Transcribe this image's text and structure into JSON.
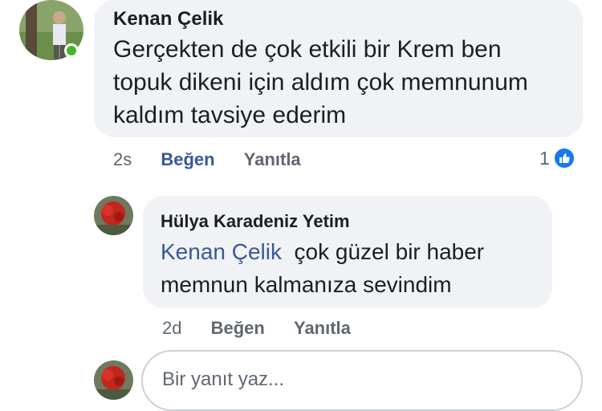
{
  "comments": [
    {
      "author": "Kenan Çelik",
      "text_lines": [
        "Gerçekten de çok etkili bir Krem ben",
        "topuk dikeni için aldım çok memnunum",
        "kaldım tavsiye ederim"
      ],
      "time": "2s",
      "like_label": "Beğen",
      "reply_label": "Yanıtla",
      "reaction_count": "1",
      "reaction_icon": "like-icon",
      "online": true
    },
    {
      "author": "Hülya Karadeniz Yetim",
      "mention": "Kenan Çelik",
      "text_first": "çok güzel bir haber",
      "text_second": "memnun kalmanıza sevindim",
      "time": "2d",
      "like_label": "Beğen",
      "reply_label": "Yanıtla"
    }
  ],
  "reply_input": {
    "placeholder": "Bir yanıt yaz..."
  },
  "colors": {
    "bubble": "#f0f2f5",
    "link": "#385898",
    "online": "#42b72a",
    "like": "#1877f2"
  }
}
